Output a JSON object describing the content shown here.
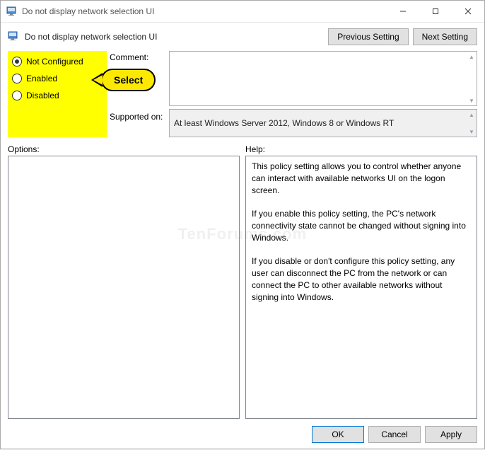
{
  "window": {
    "title": "Do not display network selection UI"
  },
  "page": {
    "heading": "Do not display network selection UI"
  },
  "nav": {
    "previous": "Previous Setting",
    "next": "Next Setting"
  },
  "radios": {
    "not_configured": "Not Configured",
    "enabled": "Enabled",
    "disabled": "Disabled",
    "selected": "not_configured"
  },
  "fields": {
    "comment_label": "Comment:",
    "comment_value": "",
    "supported_label": "Supported on:",
    "supported_value": "At least Windows Server 2012, Windows 8 or Windows RT"
  },
  "sections": {
    "options_label": "Options:",
    "help_label": "Help:",
    "options_content": "",
    "help_content": "This policy setting allows you to control whether anyone can interact with available networks UI on the logon screen.\n\nIf you enable this policy setting, the PC's network connectivity state cannot be changed without signing into Windows.\n\nIf you disable or don't configure this policy setting, any user can disconnect the PC from the network or can connect the PC to other available networks without signing into Windows."
  },
  "footer": {
    "ok": "OK",
    "cancel": "Cancel",
    "apply": "Apply"
  },
  "callout": {
    "text": "Select"
  },
  "watermark": "TenForums.com"
}
